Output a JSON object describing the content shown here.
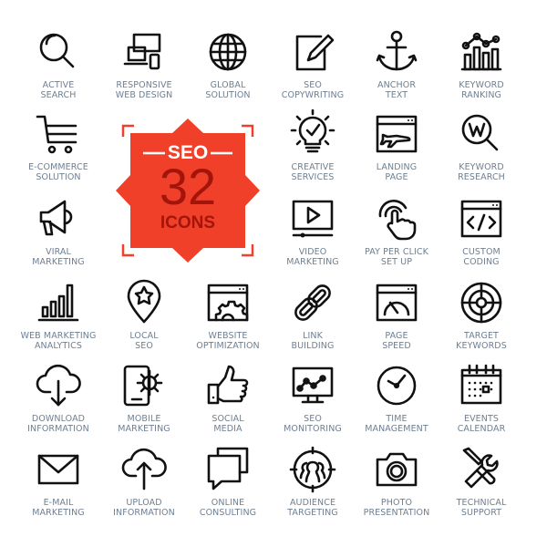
{
  "badge": {
    "top": "SEO",
    "number": "32",
    "bottom": "ICONS",
    "color": "#f0402a",
    "text_dark": "#a3150b"
  },
  "label_color": "#6e7f91",
  "icons": [
    {
      "icon": "magnifier-icon",
      "line1": "ACTIVE",
      "line2": "SEARCH"
    },
    {
      "icon": "devices-icon",
      "line1": "RESPONSIVE",
      "line2": "WEB DESIGN"
    },
    {
      "icon": "globe-icon",
      "line1": "GLOBAL",
      "line2": "SOLUTION"
    },
    {
      "icon": "pencil-square-icon",
      "line1": "SEO",
      "line2": "COPYWRITING"
    },
    {
      "icon": "anchor-icon",
      "line1": "ANCHOR",
      "line2": "TEXT"
    },
    {
      "icon": "bar-line-chart-icon",
      "line1": "KEYWORD",
      "line2": "RANKING"
    },
    {
      "icon": "shopping-cart-icon",
      "line1": "E-COMMERCE",
      "line2": "SOLUTION"
    },
    {
      "icon": "lightbulb-check-icon",
      "line1": "CREATIVE",
      "line2": "SERVICES"
    },
    {
      "icon": "browser-plane-icon",
      "line1": "LANDING",
      "line2": "PAGE"
    },
    {
      "icon": "keyword-search-icon",
      "line1": "KEYWORD",
      "line2": "RESEARCH"
    },
    {
      "icon": "megaphone-icon",
      "line1": "VIRAL",
      "line2": "MARKETING"
    },
    {
      "icon": "video-player-icon",
      "line1": "VIDEO",
      "line2": "MARKETING"
    },
    {
      "icon": "hand-click-icon",
      "line1": "PAY PER CLICK",
      "line2": "SET UP"
    },
    {
      "icon": "code-window-icon",
      "line1": "CUSTOM",
      "line2": "CODING"
    },
    {
      "icon": "bar-chart-icon",
      "line1": "WEB MARKETING",
      "line2": "ANALYTICS"
    },
    {
      "icon": "map-pin-star-icon",
      "line1": "LOCAL",
      "line2": "SEO"
    },
    {
      "icon": "browser-gear-icon",
      "line1": "WEBSITE",
      "line2": "OPTIMIZATION"
    },
    {
      "icon": "chain-link-icon",
      "line1": "LINK",
      "line2": "BUILDING"
    },
    {
      "icon": "browser-gauge-icon",
      "line1": "PAGE",
      "line2": "SPEED"
    },
    {
      "icon": "target-icon",
      "line1": "TARGET",
      "line2": "KEYWORDS"
    },
    {
      "icon": "cloud-download-icon",
      "line1": "DOWNLOAD",
      "line2": "INFORMATION"
    },
    {
      "icon": "mobile-gear-icon",
      "line1": "MOBILE",
      "line2": "MARKETING"
    },
    {
      "icon": "thumbs-up-icon",
      "line1": "SOCIAL",
      "line2": "MEDIA"
    },
    {
      "icon": "monitor-chart-icon",
      "line1": "SEO",
      "line2": "MONITORING"
    },
    {
      "icon": "clock-icon",
      "line1": "TIME",
      "line2": "MANAGEMENT"
    },
    {
      "icon": "calendar-icon",
      "line1": "EVENTS",
      "line2": "CALENDAR"
    },
    {
      "icon": "envelope-icon",
      "line1": "E-MAIL",
      "line2": "MARKETING"
    },
    {
      "icon": "cloud-upload-icon",
      "line1": "UPLOAD",
      "line2": "INFORMATION"
    },
    {
      "icon": "chat-bubbles-icon",
      "line1": "ONLINE",
      "line2": "CONSULTING"
    },
    {
      "icon": "audience-target-icon",
      "line1": "AUDIENCE",
      "line2": "TARGETING"
    },
    {
      "icon": "camera-icon",
      "line1": "PHOTO",
      "line2": "PRESENTATION"
    },
    {
      "icon": "wrench-screwdriver-icon",
      "line1": "TECHNICAL",
      "line2": "SUPPORT"
    }
  ]
}
